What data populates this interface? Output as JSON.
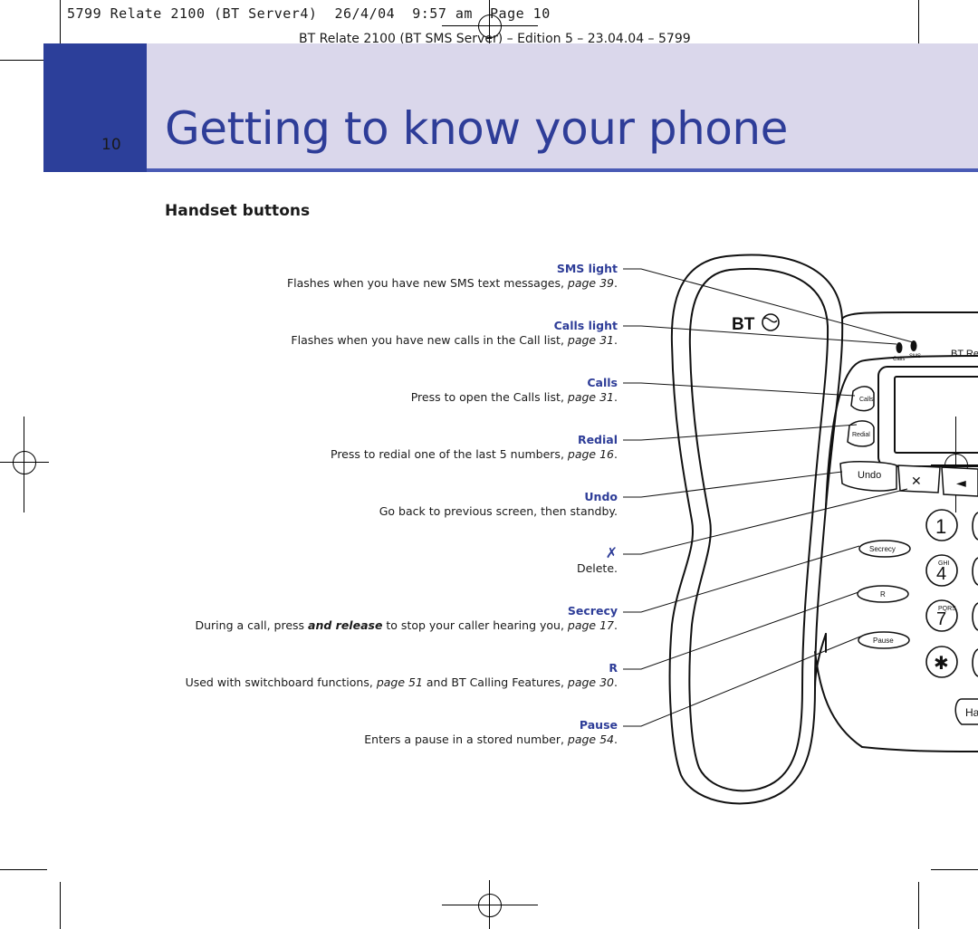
{
  "slug_line": "5799 Relate 2100 (BT Server4)  26/4/04  9:57 am  Page 10",
  "edition_line": "BT Relate 2100 (BT SMS Server) – Edition 5 – 23.04.04 – 5799",
  "page_number": "10",
  "title": "Getting to know your phone",
  "section_heading": "Handset buttons",
  "items": [
    {
      "label": "SMS light",
      "desc_before": "Flashes when you have new SMS text messages, ",
      "page_ref": "page 39",
      "desc_after": "."
    },
    {
      "label": "Calls light",
      "desc_before": "Flashes when you have new calls in the Call list, ",
      "page_ref": "page 31",
      "desc_after": "."
    },
    {
      "label": "Calls",
      "desc_before": "Press to open the Calls list, ",
      "page_ref": "page 31",
      "desc_after": "."
    },
    {
      "label": "Redial",
      "desc_before": "Press to redial one of the last 5 numbers, ",
      "page_ref": "page 16",
      "desc_after": "."
    },
    {
      "label": "Undo",
      "desc_before": "Go back to previous screen, then standby.",
      "page_ref": "",
      "desc_after": ""
    },
    {
      "label": "✗",
      "desc_before": "Delete.",
      "page_ref": "",
      "desc_after": ""
    },
    {
      "label": "Secrecy",
      "desc_before": "During a call, press ",
      "emph": "and release",
      "desc_mid": " to stop your caller hearing you, ",
      "page_ref": "page 17",
      "desc_after": "."
    },
    {
      "label": "R",
      "desc_before": "Used with switchboard functions, ",
      "page_ref": "page 51",
      "desc_mid2": " and BT Calling Features, ",
      "page_ref2": "page 30",
      "desc_after": "."
    },
    {
      "label": "Pause",
      "desc_before": "Enters a pause in a stored number, ",
      "page_ref": "page 54",
      "desc_after": "."
    }
  ],
  "phone": {
    "logo": "BT",
    "brand_partial": "BT Re",
    "led_labels": [
      "Calls",
      "SMS"
    ],
    "buttons": {
      "calls": "Calls",
      "redial": "Redial",
      "undo": "Undo",
      "delete_icon": "✕",
      "volume_icon": "◄",
      "secrecy": "Secrecy",
      "r": "R",
      "pause": "Pause",
      "hands_partial": "Ha"
    },
    "keys": [
      {
        "digit": "1",
        "letters": ""
      },
      {
        "digit": "4",
        "letters": "GHI"
      },
      {
        "digit": "7",
        "letters": "PQRS"
      },
      {
        "digit": "✱",
        "letters": ""
      }
    ]
  }
}
